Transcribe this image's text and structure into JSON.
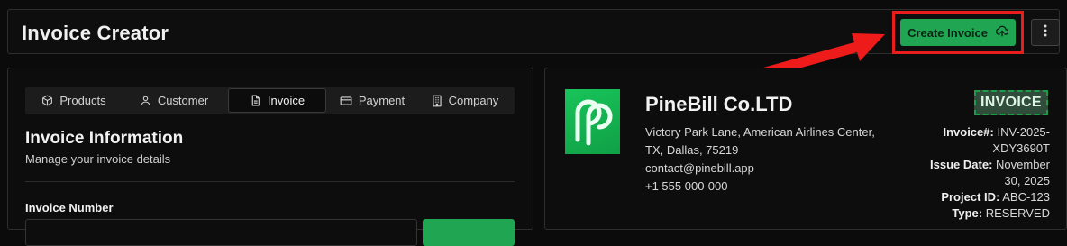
{
  "header": {
    "title": "Invoice Creator",
    "create_button_label": "Create Invoice",
    "create_button_icon": "cloud-upload-icon",
    "more_icon": "more-vertical-icon"
  },
  "tabs": [
    {
      "label": "Products",
      "icon": "box-icon"
    },
    {
      "label": "Customer",
      "icon": "user-icon"
    },
    {
      "label": "Invoice",
      "icon": "file-icon"
    },
    {
      "label": "Payment",
      "icon": "credit-card-icon"
    },
    {
      "label": "Company",
      "icon": "building-icon"
    }
  ],
  "active_tab": "Invoice",
  "section": {
    "title": "Invoice Information",
    "subtitle": "Manage your invoice details",
    "field_label": "Invoice Number"
  },
  "preview": {
    "company_name": "PineBill Co.LTD",
    "address_line1": "Victory Park Lane, American Airlines Center,",
    "address_line2": "TX, Dallas, 75219",
    "email": "contact@pinebill.app",
    "phone": "+1 555 000-000",
    "badge": "INVOICE",
    "invoice_no_label": "Invoice#:",
    "invoice_no_part1": "INV-2025-",
    "invoice_no_part2": "XDY3690T",
    "issue_date_label": "Issue Date:",
    "issue_date_part1": "November",
    "issue_date_part2": "30, 2025",
    "project_id_label": "Project ID:",
    "project_id": "ABC-123",
    "type_label": "Type:",
    "type_value": "RESERVED"
  },
  "colors": {
    "accent_green": "#20a552",
    "highlight_red": "#e81e1e",
    "background": "#0b0b0b"
  }
}
